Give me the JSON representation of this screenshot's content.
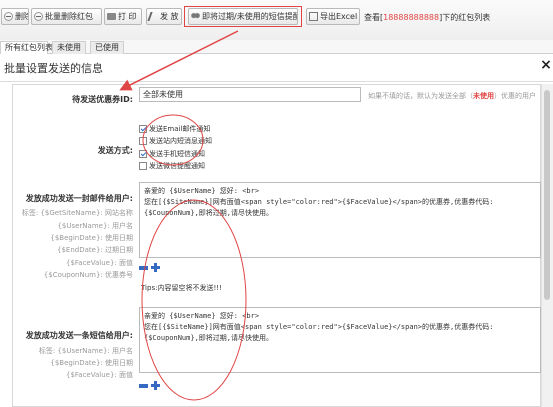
{
  "toolbar": {
    "buttons": [
      {
        "label": "删除"
      },
      {
        "label": "批量删除红包"
      },
      {
        "label": "打 印"
      },
      {
        "label": "发 放"
      },
      {
        "label": "即将过期/未使用的短信提醒"
      },
      {
        "label": "导出Excel"
      }
    ],
    "query_prefix": "查看[",
    "query_phone": "18888888888",
    "query_suffix": "]下的红包列表"
  },
  "tabs": [
    {
      "label": "所有红包列表",
      "active": true
    },
    {
      "label": "未使用",
      "active": false
    },
    {
      "label": "已使用",
      "active": false
    }
  ],
  "dialog": {
    "title": "批量设置发送的信息",
    "close_glyph": "×",
    "coupon_label": "待发送优惠券ID:",
    "coupon_value": "全部未使用",
    "coupon_note_a": "如果不填的话，默认为发送全部（",
    "coupon_note_red": "未使用",
    "coupon_note_b": "）优惠的用户",
    "method_label": "发送方式:",
    "methods": [
      {
        "label": "发送Email邮件通知",
        "checked": true
      },
      {
        "label": "发送站内短消息通知",
        "checked": false
      },
      {
        "label": "发送手机短信通知",
        "checked": true
      },
      {
        "label": "发送微信提醒通知",
        "checked": false
      }
    ],
    "email_label": "发放成功发送一封邮件给用户:",
    "email_hints": [
      "标签:  {$GetSiteName}: 网站名称",
      "{$UserName}: 用户名",
      "{$BeginDate}: 使用日期",
      "{$EndDate}: 过期日期",
      "{$FaceValue}: 面值",
      "{$CouponNum}: 优惠券号"
    ],
    "email_lines": [
      "亲爱的 {$UserName} 您好: <br>",
      "您在[{$SiteName}]网有面值<span style=\"color:red\">{$FaceValue}</span>的优惠券,优惠券代码:",
      "{$CouponNum},即将过期,请尽快使用。"
    ],
    "tips": "Tips:内容留空将不发送!!!",
    "sms_label": "发放成功发送一条短信给用户:",
    "sms_hints": [
      "标签:  {$UserName}: 用户名",
      "{$BeginDate}: 使用日期",
      "{$FaceValue}: 面值"
    ],
    "sms_lines": [
      "亲爱的 {$UserName} 您好: <br>",
      "您在[{$SiteName}]网有面值<span style=\"color:red\">{$FaceValue}</span>的优惠券,优惠券代码:",
      "{$CouponNum},即将过期,请尽快使用。"
    ]
  },
  "colors": {
    "annotation_red": "#e04545",
    "accent_blue": "#3569c2"
  }
}
